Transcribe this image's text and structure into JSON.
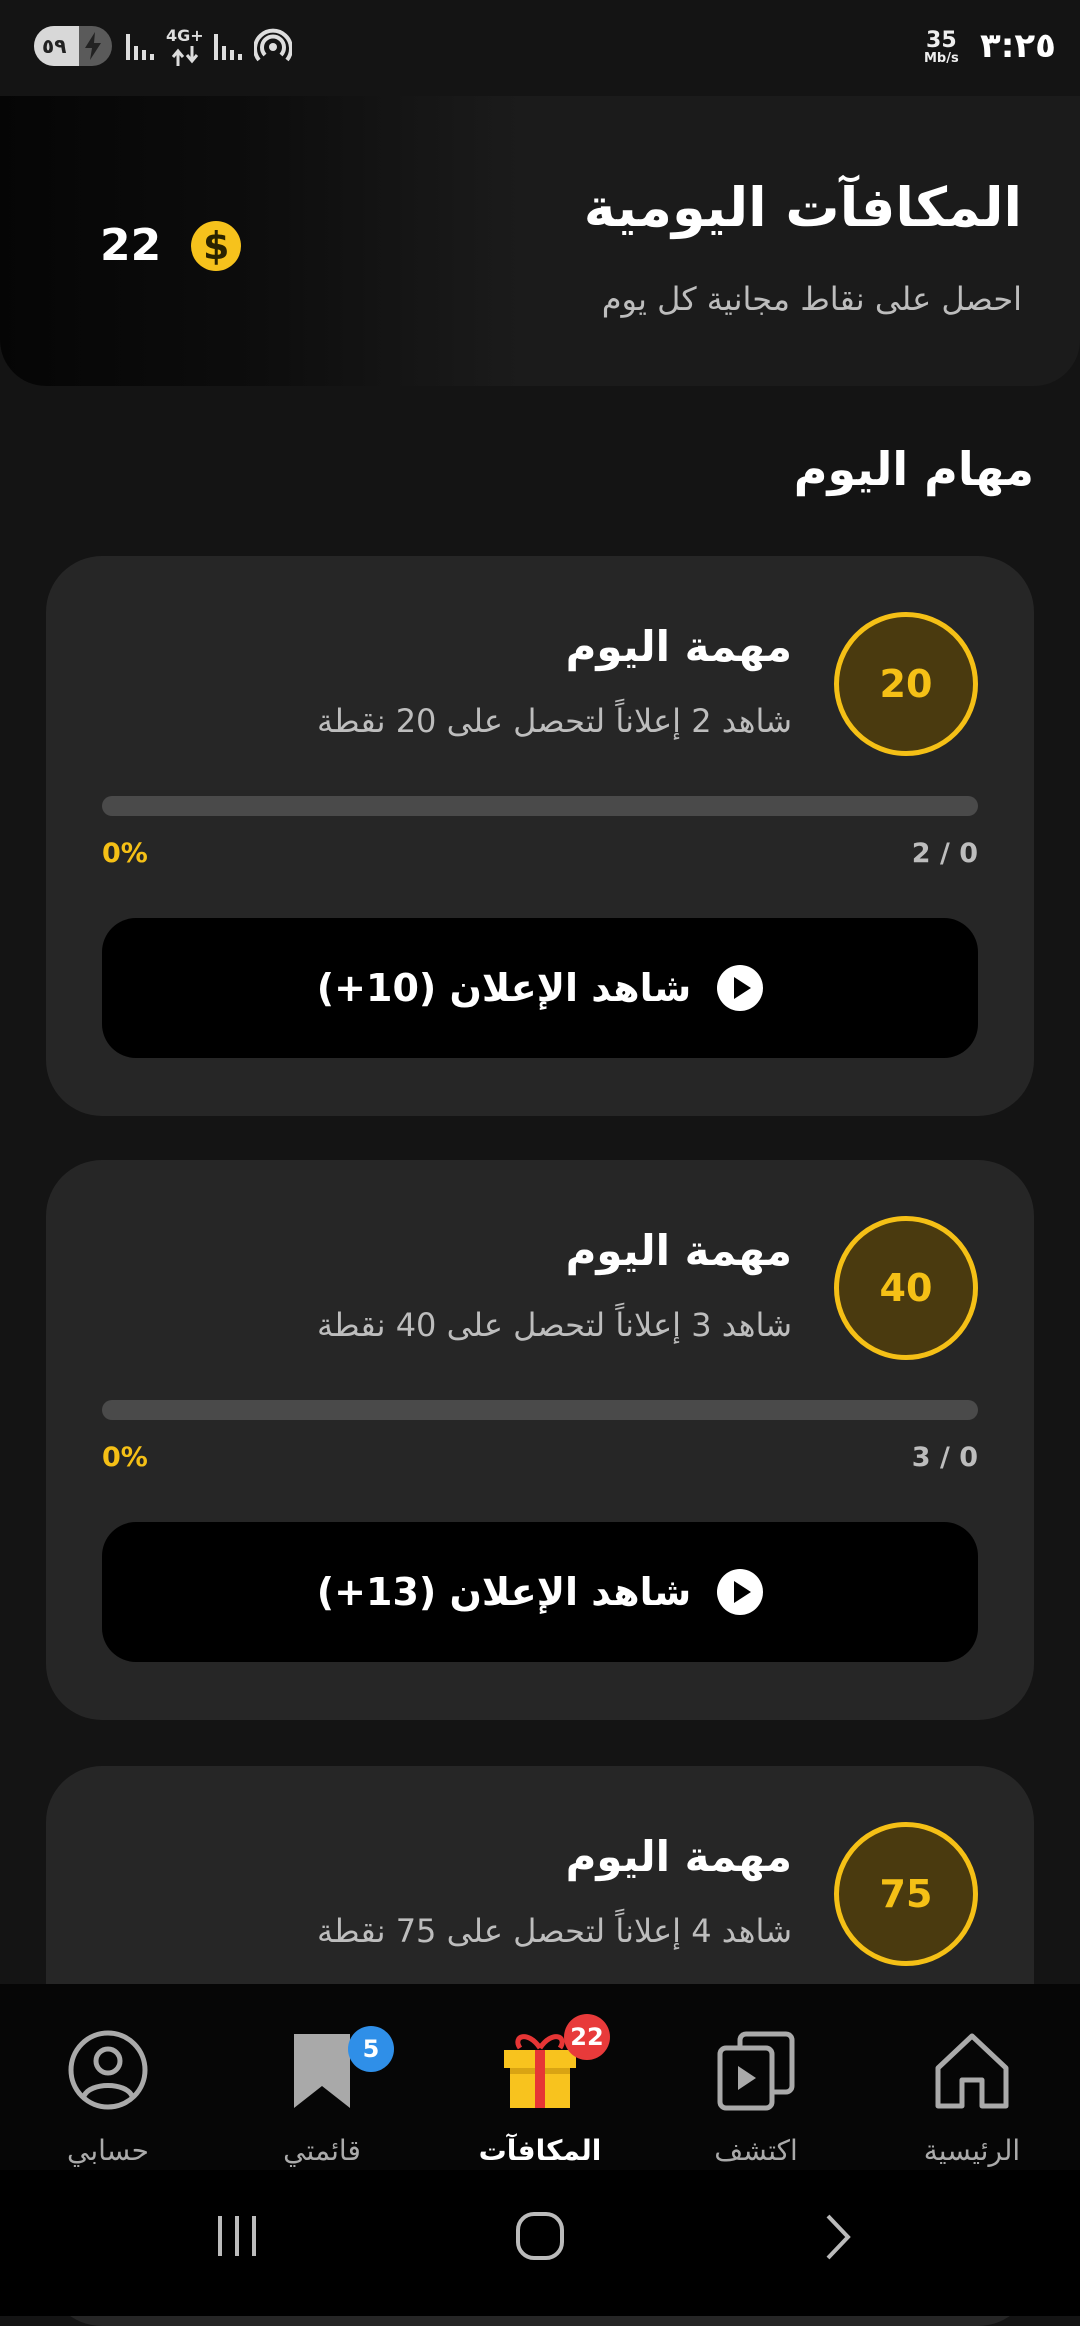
{
  "status_bar": {
    "battery_level": "٥٩",
    "network_type": "4G+",
    "speed_value": "35",
    "speed_unit": "Mb/s",
    "time": "٣:٢٥"
  },
  "header": {
    "title": "المكافآت اليومية",
    "subtitle": "احصل على نقاط مجانية كل يوم",
    "points_balance": "22",
    "coin_symbol": "$"
  },
  "tasks_section": {
    "title": "مهام اليوم",
    "tasks": [
      {
        "title": "مهمة اليوم",
        "description": "شاهد 2 إعلاناً لتحصل على 20 نقطة",
        "reward": "20",
        "progress_percent": "0%",
        "progress_fraction": 0,
        "progress_count": "2 / 0",
        "button_label": "شاهد الإعلان (10+)"
      },
      {
        "title": "مهمة اليوم",
        "description": "شاهد 3 إعلاناً لتحصل على 40 نقطة",
        "reward": "40",
        "progress_percent": "0%",
        "progress_fraction": 0,
        "progress_count": "3 / 0",
        "button_label": "شاهد الإعلان (13+)"
      },
      {
        "title": "مهمة اليوم",
        "description": "شاهد 4 إعلاناً لتحصل على 75 نقطة",
        "reward": "75"
      }
    ]
  },
  "bottom_nav": {
    "items": [
      {
        "label": "حسابي",
        "icon": "profile-icon"
      },
      {
        "label": "قائمتي",
        "icon": "bookmark-icon",
        "badge": "5"
      },
      {
        "label": "المكافآت",
        "icon": "gift-icon",
        "badge": "22",
        "active": true
      },
      {
        "label": "اكتشف",
        "icon": "discover-icon"
      },
      {
        "label": "الرئيسية",
        "icon": "home-icon"
      }
    ]
  },
  "colors": {
    "accent": "#f5c016",
    "background": "#141414",
    "card": "#262626",
    "badge_blue": "#2f8fe8",
    "badge_red": "#e83a3a"
  }
}
